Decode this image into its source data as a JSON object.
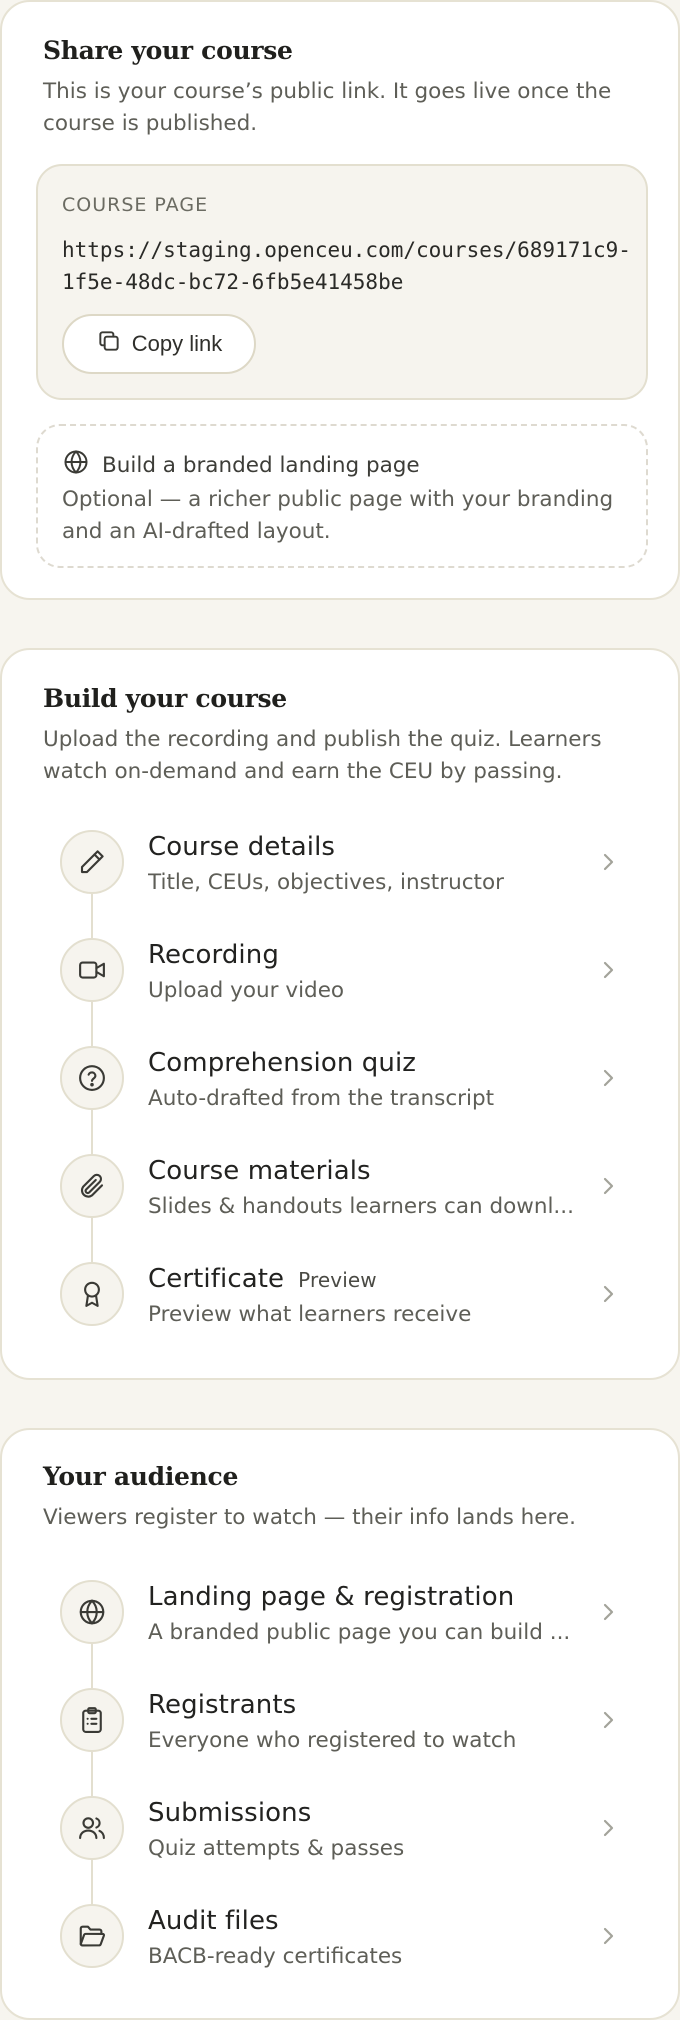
{
  "share": {
    "title": "Share your course",
    "description": "This is your course’s public link. It goes live once the course is published.",
    "link_label": "COURSE PAGE",
    "url": "https://staging.openceu.com/courses/689171c9-1f5e-48dc-bc72-6fb5e41458be",
    "copy_label": "Copy link",
    "branded_title": "Build a branded landing page",
    "branded_desc": "Optional — a richer public page with your branding and an AI-drafted layout."
  },
  "build": {
    "title": "Build your course",
    "description": "Upload the recording and publish the quiz. Learners watch on-demand and earn the CEU by passing.",
    "steps": [
      {
        "title": "Course details",
        "subtitle": "Title, CEUs, objectives, instructor",
        "icon": "pencil-icon",
        "badge": ""
      },
      {
        "title": "Recording",
        "subtitle": "Upload your video",
        "icon": "video-camera-icon",
        "badge": ""
      },
      {
        "title": "Comprehension quiz",
        "subtitle": "Auto-drafted from the transcript",
        "icon": "question-circle-icon",
        "badge": ""
      },
      {
        "title": "Course materials",
        "subtitle": "Slides & handouts learners can downl...",
        "icon": "paperclip-icon",
        "badge": ""
      },
      {
        "title": "Certificate",
        "subtitle": "Preview what learners receive",
        "icon": "award-icon",
        "badge": "Preview"
      }
    ]
  },
  "audience": {
    "title": "Your audience",
    "description": "Viewers register to watch — their info lands here.",
    "steps": [
      {
        "title": "Landing page & registration",
        "subtitle": "A branded public page you can build ...",
        "icon": "globe-icon"
      },
      {
        "title": "Registrants",
        "subtitle": "Everyone who registered to watch",
        "icon": "clipboard-icon"
      },
      {
        "title": "Submissions",
        "subtitle": "Quiz attempts & passes",
        "icon": "users-icon"
      },
      {
        "title": "Audit files",
        "subtitle": "BACB-ready certificates",
        "icon": "folder-icon"
      }
    ]
  },
  "colors": {
    "background": "#f7f5ef",
    "card": "#ffffff",
    "border": "#e6e2d3",
    "muted_text": "#5e5e57",
    "heading_text": "#20201d"
  }
}
